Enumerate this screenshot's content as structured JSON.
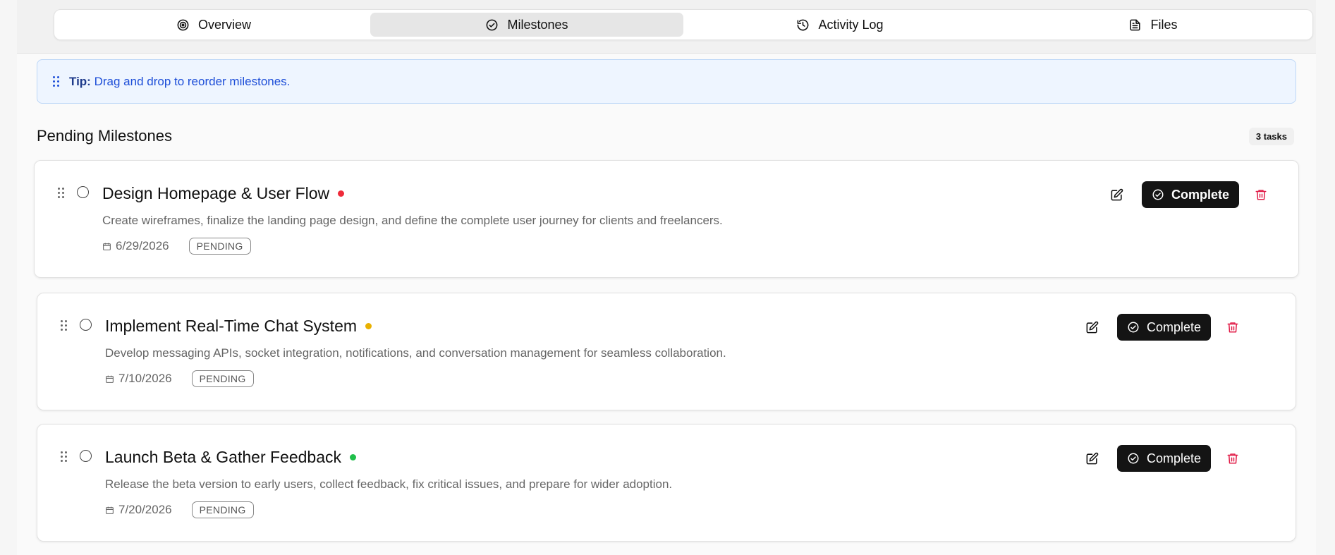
{
  "tabs": [
    {
      "label": "Overview",
      "icon": "target-icon",
      "active": false
    },
    {
      "label": "Milestones",
      "icon": "check-circle-icon",
      "active": true
    },
    {
      "label": "Activity Log",
      "icon": "history-icon",
      "active": false
    },
    {
      "label": "Files",
      "icon": "file-text-icon",
      "active": false
    }
  ],
  "tip": {
    "label": "Tip:",
    "text": "Drag and drop to reorder milestones."
  },
  "section": {
    "title": "Pending Milestones",
    "count": "3 tasks"
  },
  "milestones": [
    {
      "title": "Design Homepage & User Flow",
      "priority_color": "#ef2b3a",
      "description": "Create wireframes, finalize the landing page design, and define the complete user journey for clients and freelancers.",
      "date": "6/29/2026",
      "status": "PENDING",
      "complete_label": "Complete"
    },
    {
      "title": "Implement Real-Time Chat System",
      "priority_color": "#e9b100",
      "description": "Develop messaging APIs, socket integration, notifications, and conversation management for seamless collaboration.",
      "date": "7/10/2026",
      "status": "PENDING",
      "complete_label": "Complete"
    },
    {
      "title": "Launch Beta & Gather Feedback",
      "priority_color": "#1fbf4a",
      "description": "Release the beta version to early users, collect feedback, fix critical issues, and prepare for wider adoption.",
      "date": "7/20/2026",
      "status": "PENDING",
      "complete_label": "Complete"
    }
  ],
  "colors": {
    "accent": "#141414",
    "tip_bg": "#eef5ff",
    "tip_text": "#1d4ed8",
    "delete": "#e11d48"
  }
}
